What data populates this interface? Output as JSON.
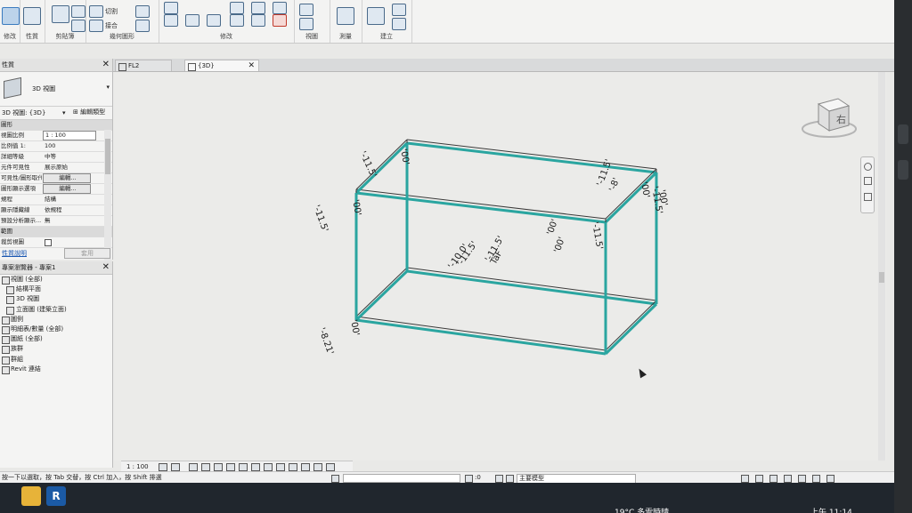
{
  "ribbon": {
    "groups": [
      {
        "label": "修改"
      },
      {
        "label": "性質"
      },
      {
        "label": "剪貼簿"
      },
      {
        "label": "幾何圖形"
      },
      {
        "label": "修改"
      },
      {
        "label": "視圖"
      },
      {
        "label": "測量"
      },
      {
        "label": "建立"
      }
    ],
    "cut_label": "切割",
    "join_label": "接合"
  },
  "properties": {
    "title": "性質",
    "type_name": "3D 視圖",
    "filter_value": "3D 視圖: {3D}",
    "edit_type_label": "編輯類型",
    "section_graphics": "圖形",
    "rows": [
      {
        "key": "視圖比例",
        "value": "1 : 100",
        "style": "boxed"
      },
      {
        "key": "比例值 1:",
        "value": "100",
        "style": "plain"
      },
      {
        "key": "詳細等級",
        "value": "中等",
        "style": "plain"
      },
      {
        "key": "元件可見性",
        "value": "展示原始",
        "style": "plain"
      },
      {
        "key": "可見性/圖形取代",
        "value": "編輯...",
        "style": "btn"
      },
      {
        "key": "圖形顯示選項",
        "value": "編輯...",
        "style": "btn"
      },
      {
        "key": "規程",
        "value": "結構",
        "style": "plain"
      },
      {
        "key": "顯示隱藏線",
        "value": "依規程",
        "style": "plain"
      },
      {
        "key": "預設分析顯示...",
        "value": "無",
        "style": "plain"
      }
    ],
    "section_extents": "範圍",
    "crop_label": "裁剪視圖",
    "help_link": "性質說明",
    "apply_label": "套用"
  },
  "browser": {
    "title": "專案瀏覽器 - 專案1",
    "items": [
      {
        "label": "視圖 (全部)",
        "level": 0
      },
      {
        "label": "結構平面",
        "level": 1
      },
      {
        "label": "3D 視圖",
        "level": 1
      },
      {
        "label": "立面圖 (建築立面)",
        "level": 1
      },
      {
        "label": "圖例",
        "level": 0
      },
      {
        "label": "明細表/數量 (全部)",
        "level": 0
      },
      {
        "label": "圖紙 (全部)",
        "level": 0
      },
      {
        "label": "族群",
        "level": 0
      },
      {
        "label": "群組",
        "level": 0
      },
      {
        "label": "Revit 連結",
        "level": 0
      }
    ]
  },
  "tabs": [
    {
      "label": "FL2",
      "active": false
    },
    {
      "label": "{3D}",
      "active": true
    }
  ],
  "canvas": {
    "viewcube_face": "右",
    "annotations": [
      "'-11.5'",
      "'00'",
      "'-11.5'",
      "'00'",
      "'-11.5'",
      "'00'",
      "'-11.5'",
      "'00'",
      "'-11.5'",
      "'00'",
      "'-11.5'",
      "'-11.5'",
      "'-10.0'",
      "TaF",
      "'-8.21'",
      "'00'",
      "'-8'",
      "'00'"
    ],
    "frame_color": "#2aa5a0"
  },
  "view_control": {
    "scale": "1 : 100"
  },
  "status": {
    "hint": "按一下以選取，按 Tab 交替，按 Ctrl 加入，按 Shift 排選",
    "zero": ":0",
    "model": "主要模型"
  },
  "taskbar": {
    "weather": "19°C 多雲時晴",
    "clock": "上午 11:14"
  }
}
